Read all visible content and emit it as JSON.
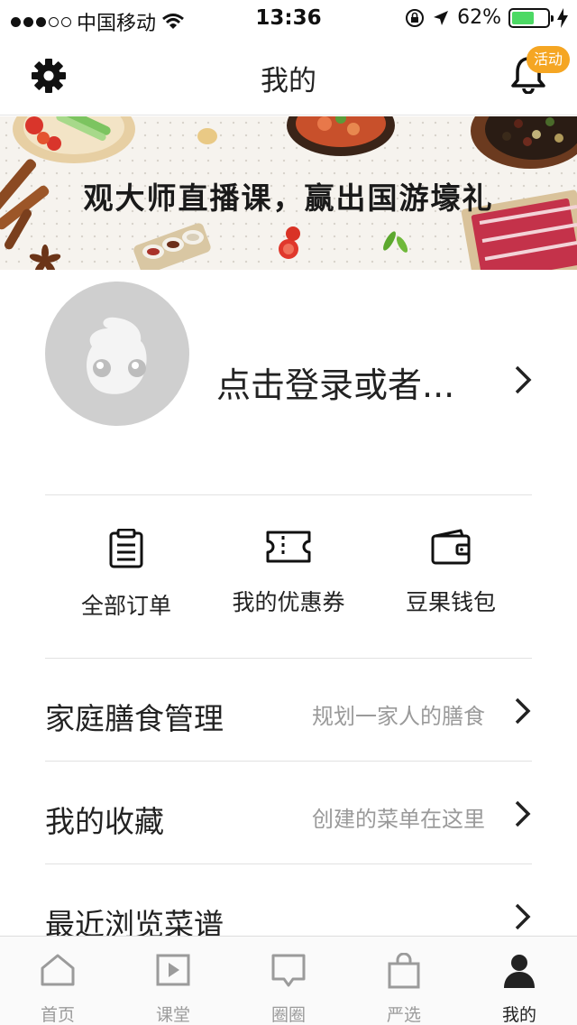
{
  "status_bar": {
    "carrier": "中国移动",
    "time": "13:36",
    "battery": "62%",
    "battery_level": 0.62,
    "signal_dots": 5,
    "signal_filled": 3
  },
  "header": {
    "title": "我的",
    "activity_badge": "活动",
    "icons": [
      "gear-icon",
      "bell-icon"
    ]
  },
  "banner": {
    "text": "观大师直播课，赢出国游壕礼"
  },
  "profile": {
    "login_prompt": "点击登录或者..."
  },
  "shortcuts": [
    {
      "label": "全部订单",
      "icon": "clipboard-icon"
    },
    {
      "label": "我的优惠券",
      "icon": "ticket-icon"
    },
    {
      "label": "豆果钱包",
      "icon": "wallet-icon"
    }
  ],
  "menu": [
    {
      "title": "家庭膳食管理",
      "hint": "规划一家人的膳食"
    },
    {
      "title": "我的收藏",
      "hint": "创建的菜单在这里"
    },
    {
      "title": "最近浏览菜谱",
      "hint": ""
    }
  ],
  "tabs": [
    {
      "label": "首页",
      "icon": "home-icon",
      "active": false
    },
    {
      "label": "课堂",
      "icon": "play-icon",
      "active": false
    },
    {
      "label": "圈圈",
      "icon": "chat-icon",
      "active": false
    },
    {
      "label": "严选",
      "icon": "bag-icon",
      "active": false
    },
    {
      "label": "我的",
      "icon": "user-icon",
      "active": true
    }
  ],
  "colors": {
    "badge": "#f5a623",
    "battery": "#4cd964",
    "avatar_bg": "#cfcfcf",
    "hint_text": "#9a9a9a",
    "inactive_tab": "#9b9b9b"
  }
}
